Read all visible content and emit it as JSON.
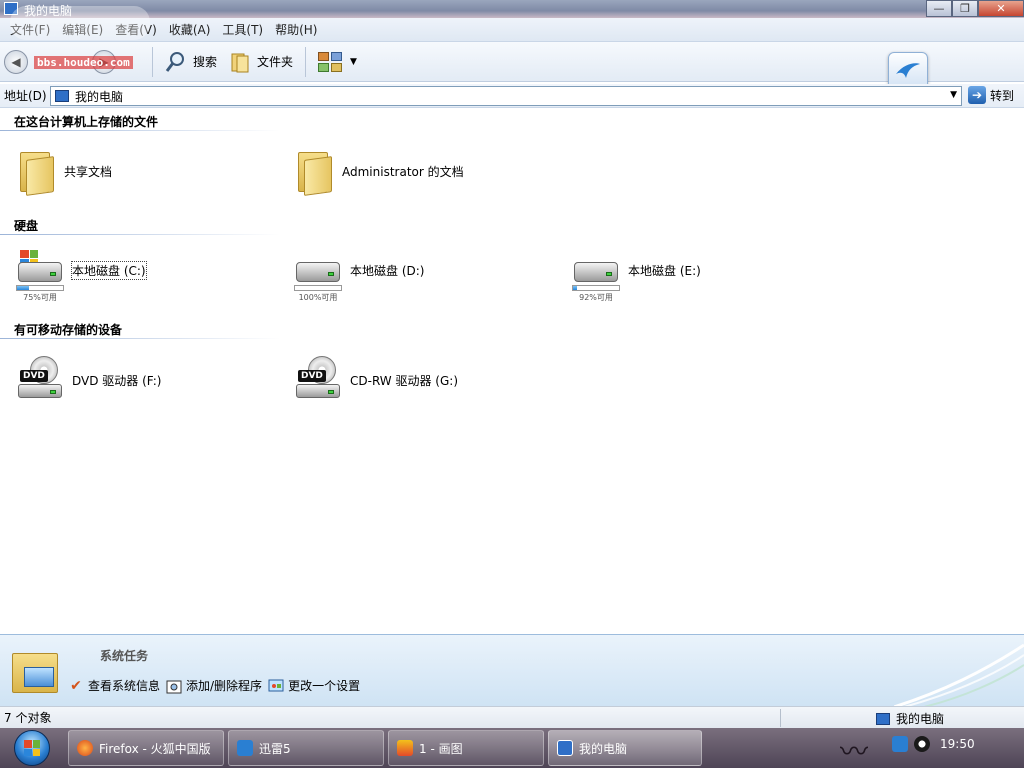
{
  "window": {
    "title": "我的电脑",
    "watermark_text": "bbs.houdeo.com",
    "minimize": "—",
    "maximize": "❐",
    "close": "✕"
  },
  "menu": [
    "文件(F)",
    "编辑(E)",
    "查看(V)",
    "收藏(A)",
    "工具(T)",
    "帮助(H)"
  ],
  "toolbar": {
    "search_label": "搜索",
    "folders_label": "文件夹"
  },
  "address": {
    "label": "地址(D)",
    "value": "我的电脑",
    "go_label": "转到"
  },
  "sections": {
    "stored": "在这台计算机上存储的文件",
    "hard_disks": "硬盘",
    "removable": "有可移动存储的设备"
  },
  "folders": [
    {
      "label": "共享文档"
    },
    {
      "label": "Administrator 的文档"
    }
  ],
  "drives": [
    {
      "label": "本地磁盘 (C:)",
      "free_text": "75%可用",
      "free_fraction": 0.75
    },
    {
      "label": "本地磁盘 (D:)",
      "free_text": "100%可用",
      "free_fraction": 1.0
    },
    {
      "label": "本地磁盘 (E:)",
      "free_text": "92%可用",
      "free_fraction": 0.92
    }
  ],
  "removable": [
    {
      "label": "DVD 驱动器 (F:)",
      "badge": "DVD"
    },
    {
      "label": "CD-RW 驱动器 (G:)",
      "badge": "DVD"
    }
  ],
  "task_pane": {
    "title": "系统任务",
    "tasks": [
      "查看系统信息",
      "添加/删除程序",
      "更改一个设置"
    ]
  },
  "status": {
    "count": "7 个对象",
    "location": "我的电脑"
  },
  "taskbar": {
    "buttons": [
      "Firefox - 火狐中国版",
      "迅雷5",
      "1 - 画图",
      "我的电脑"
    ],
    "clock": "19:50"
  },
  "colors": {
    "accent": "#2a86db",
    "taskbar": "#5e5466"
  }
}
